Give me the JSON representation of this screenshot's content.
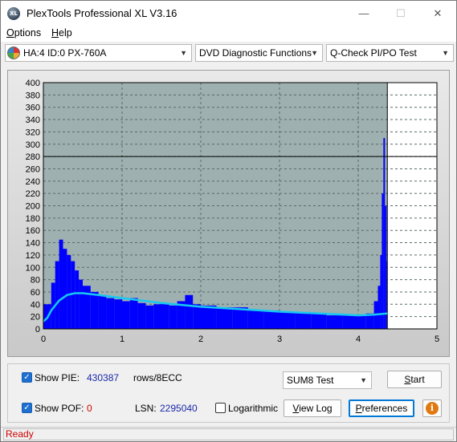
{
  "window": {
    "title": "PlexTools Professional XL V3.16",
    "icon_text": "XL",
    "minimize_glyph": "—",
    "maximize_glyph": "☐",
    "close_glyph": "✕"
  },
  "menu": {
    "options_first": "O",
    "options_rest": "ptions",
    "help_first": "H",
    "help_rest": "elp"
  },
  "toolbar": {
    "drive": "HA:4 ID:0  PX-760A",
    "function": "DVD Diagnostic Functions",
    "test": "Q-Check PI/PO Test"
  },
  "chart_data": {
    "type": "bar",
    "title": "",
    "xlabel": "",
    "ylabel": "",
    "xlim": [
      0,
      5
    ],
    "ylim": [
      0,
      400
    ],
    "x_ticks": [
      "0",
      "1",
      "2",
      "3",
      "4",
      "5"
    ],
    "y_ticks": [
      "0",
      "20",
      "40",
      "60",
      "80",
      "100",
      "120",
      "140",
      "160",
      "180",
      "200",
      "220",
      "240",
      "260",
      "280",
      "300",
      "320",
      "340",
      "360",
      "380",
      "400"
    ],
    "threshold_y": 280,
    "end_marker_x": 4.37,
    "grid": true,
    "colors": {
      "bars": "#0000ff",
      "average": "#18c8f0",
      "plot_bg": "#9fb0b0",
      "plot_bg_after": "#ffffff"
    },
    "series": [
      {
        "type": "bar",
        "x": [
          0.05,
          0.1,
          0.15,
          0.2,
          0.25,
          0.3,
          0.35,
          0.4,
          0.45,
          0.5,
          0.6,
          0.7,
          0.8,
          0.9,
          1.0,
          1.1,
          1.2,
          1.3,
          1.4,
          1.5,
          1.6,
          1.7,
          1.8,
          1.9,
          2.0,
          2.2,
          2.4,
          2.6,
          2.8,
          3.0,
          3.2,
          3.4,
          3.6,
          3.8,
          4.0,
          4.1,
          4.2,
          4.25,
          4.28,
          4.3,
          4.32,
          4.34,
          4.36
        ],
        "values": [
          40,
          75,
          110,
          145,
          130,
          120,
          110,
          95,
          80,
          70,
          60,
          55,
          50,
          48,
          45,
          50,
          42,
          38,
          40,
          42,
          38,
          45,
          55,
          40,
          38,
          35,
          35,
          30,
          30,
          28,
          26,
          25,
          22,
          22,
          22,
          25,
          45,
          70,
          120,
          220,
          310,
          200,
          110
        ]
      },
      {
        "type": "line",
        "x": [
          0.0,
          0.05,
          0.1,
          0.2,
          0.3,
          0.4,
          0.5,
          0.7,
          1.0,
          1.5,
          2.0,
          2.5,
          3.0,
          3.5,
          4.0,
          4.2,
          4.37
        ],
        "values": [
          12,
          18,
          30,
          46,
          55,
          58,
          58,
          55,
          50,
          42,
          36,
          32,
          28,
          25,
          22,
          23,
          25
        ]
      }
    ]
  },
  "controls": {
    "show_pie_label": "Show PIE:",
    "pie_value": "430387",
    "rows_label": "rows/8ECC",
    "show_pof_label": "Show POF:",
    "pof_value": "0",
    "lsn_label": "LSN:",
    "lsn_value": "2295040",
    "logarithmic_label": "Logarithmic",
    "test_select": "SUM8 Test",
    "start_first": "S",
    "start_rest": "tart",
    "view_log_first": "V",
    "view_log_rest": "iew Log",
    "preferences_first": "P",
    "preferences_rest": "references",
    "info_glyph": "i",
    "checkmark": "✓"
  },
  "status": {
    "text": "Ready"
  }
}
